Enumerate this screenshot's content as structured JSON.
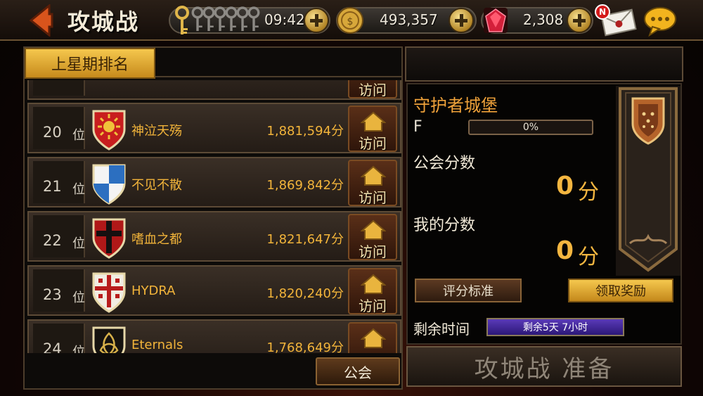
{
  "header": {
    "title": "攻城战",
    "keys_count": 7,
    "timer": "09:42",
    "gold": "493,357",
    "gems": "2,308",
    "mail_badge": "N"
  },
  "left": {
    "tab_label": "上星期排名",
    "visit_label": "访问",
    "rank_unit": "位",
    "guild_button": "公会",
    "rows": [
      {
        "rank": "20",
        "name": "神泣天殇",
        "score": "1,881,594分",
        "crest": "sun-crest-icon"
      },
      {
        "rank": "21",
        "name": "不见不散",
        "score": "1,869,842分",
        "crest": "checkered-shield-icon"
      },
      {
        "rank": "22",
        "name": "嗜血之都",
        "score": "1,821,647分",
        "crest": "black-cross-shield-icon"
      },
      {
        "rank": "23",
        "name": "HYDRA",
        "score": "1,820,240分",
        "crest": "red-cross-shield-icon"
      },
      {
        "rank": "24",
        "name": "Eternals",
        "score": "1,768,649分",
        "crest": "triquetra-shield-icon"
      }
    ]
  },
  "right": {
    "castle_title": "守护者城堡",
    "grade": "F",
    "progress_text": "0%",
    "progress_value": 0,
    "guild_score_label": "公会分数",
    "guild_score_value": "0",
    "my_score_label": "我的分数",
    "my_score_value": "0",
    "score_unit": "分",
    "criteria_button": "评分标准",
    "reward_button": "领取奖励",
    "remain_label": "剩余时间",
    "remain_value": "剩余5天 7小时",
    "action_button": "攻城战 准备"
  },
  "colors": {
    "accent_gold": "#f4b640",
    "tab_gold": "#f5c74d",
    "remain_purple": "#5a3ab8"
  }
}
